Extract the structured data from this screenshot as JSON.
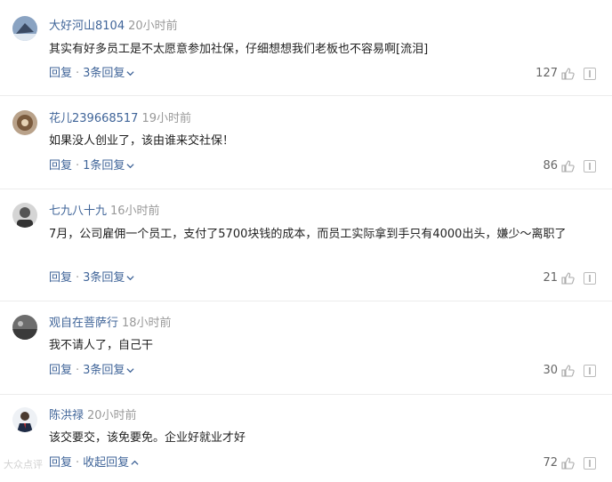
{
  "comments": [
    {
      "username": "大好河山8104",
      "time": "20小时前",
      "content": "其实有好多员工是不太愿意参加社保，仔细想想我们老板也不容易啊[流泪]",
      "reply_label": "回复",
      "replies_label": "3条回复",
      "likes": "127",
      "avatar_icon": "avatar-icon"
    },
    {
      "username": "花儿239668517",
      "time": "19小时前",
      "content": "如果没人创业了，该由谁来交社保！",
      "reply_label": "回复",
      "replies_label": "1条回复",
      "likes": "86",
      "avatar_icon": "avatar-icon"
    },
    {
      "username": "七九八十九",
      "time": "16小时前",
      "content": "7月，公司雇佣一个员工，支付了5700块钱的成本，而员工实际拿到手只有4000出头，嫌少～离职了",
      "reply_label": "回复",
      "replies_label": "3条回复",
      "likes": "21",
      "avatar_icon": "avatar-icon"
    },
    {
      "username": "观自在菩萨行",
      "time": "18小时前",
      "content": "我不请人了，自己干",
      "reply_label": "回复",
      "replies_label": "3条回复",
      "likes": "30",
      "avatar_icon": "avatar-icon"
    },
    {
      "username": "陈洪禄",
      "time": "20小时前",
      "content": "该交要交，该免要免。企业好就业才好",
      "reply_label": "回复",
      "replies_label": "收起回复",
      "likes": "72",
      "avatar_icon": "avatar-icon"
    }
  ],
  "watermark": "大众点评",
  "colors": {
    "username": "#406599",
    "time": "#999999",
    "divider": "#ececec"
  }
}
